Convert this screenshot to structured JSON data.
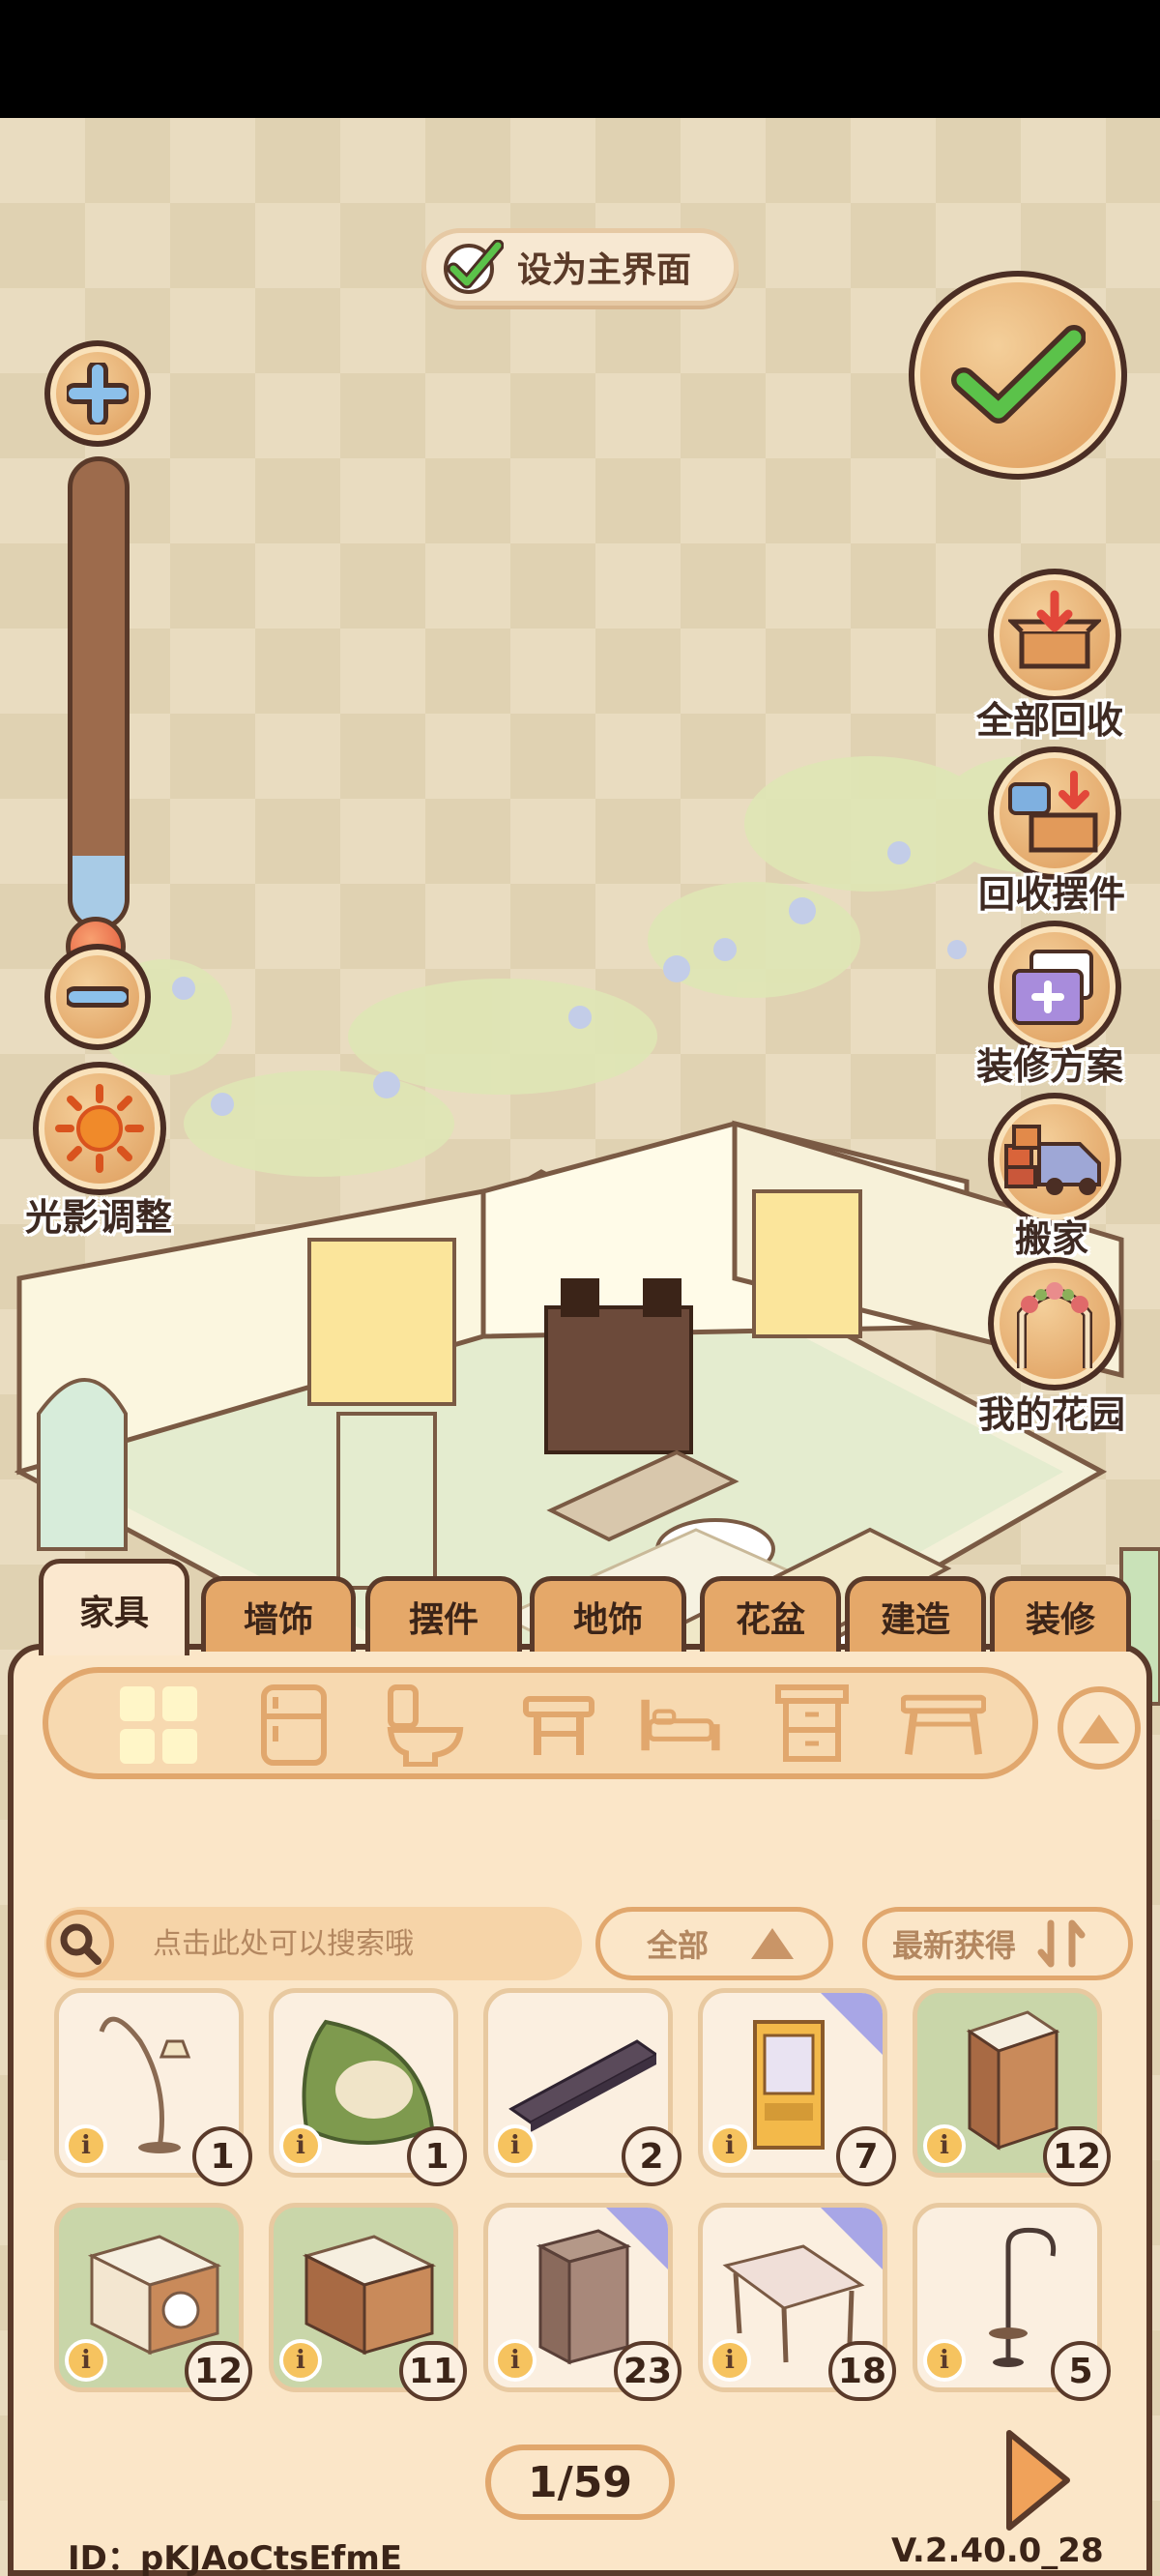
{
  "top": {
    "set_main_label": "设为主界面"
  },
  "side": {
    "light_label": "光影调整",
    "buttons": [
      {
        "label": "全部回收",
        "icon": "recycle-all-box-icon"
      },
      {
        "label": "回收摆件",
        "icon": "recycle-ornaments-icon"
      },
      {
        "label": "装修方案",
        "icon": "decoration-plan-icon"
      },
      {
        "label": "搬家",
        "icon": "moving-truck-icon"
      },
      {
        "label": "我的花园",
        "icon": "garden-arch-icon"
      }
    ]
  },
  "tabs": [
    "家具",
    "墙饰",
    "摆件",
    "地饰",
    "花盆",
    "建造",
    "装修"
  ],
  "active_tab": "家具",
  "categories": [
    "all-grid-icon",
    "fridge-icon",
    "toilet-icon",
    "stool-icon",
    "bed-icon",
    "cabinet-icon",
    "table-icon"
  ],
  "search": {
    "placeholder": "点击此处可以搜索哦"
  },
  "filters": {
    "type": "全部",
    "sort": "最新获得"
  },
  "items": [
    {
      "name": "floor-lamp",
      "count": "1",
      "new": false,
      "bg": "light"
    },
    {
      "name": "bean-bag",
      "count": "1",
      "new": false,
      "bg": "light"
    },
    {
      "name": "tv-cabinet",
      "count": "2",
      "new": false,
      "bg": "light"
    },
    {
      "name": "vending-machine",
      "count": "7",
      "new": true,
      "bg": "light"
    },
    {
      "name": "display-shelf",
      "count": "12",
      "new": false,
      "bg": "green"
    },
    {
      "name": "washing-machine-counter",
      "count": "12",
      "new": false,
      "bg": "green"
    },
    {
      "name": "wooden-counter",
      "count": "11",
      "new": false,
      "bg": "green"
    },
    {
      "name": "wardrobe",
      "count": "23",
      "new": true,
      "bg": "light"
    },
    {
      "name": "dining-table",
      "count": "18",
      "new": true,
      "bg": "light"
    },
    {
      "name": "coat-stand",
      "count": "5",
      "new": false,
      "bg": "light"
    }
  ],
  "info_glyph": "i",
  "pager": {
    "text": "1/59"
  },
  "footer": {
    "id": "ID：pKJAoCtsEfmE",
    "version": "V.2.40.0_28"
  },
  "zoom": {
    "level": 0.15
  },
  "colors": {
    "accent": "#e3a86a",
    "outline": "#5a3a2a",
    "check": "#4caf50"
  }
}
